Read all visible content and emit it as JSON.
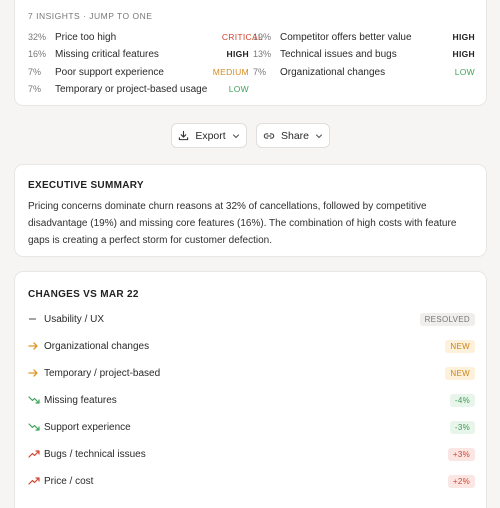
{
  "insights": {
    "header": "7 INSIGHTS · JUMP TO ONE",
    "items": [
      {
        "pct": "32%",
        "label": "Price too high",
        "severity": "CRITICAL",
        "level": "critical"
      },
      {
        "pct": "19%",
        "label": "Competitor offers better value",
        "severity": "HIGH",
        "level": "high"
      },
      {
        "pct": "16%",
        "label": "Missing critical features",
        "severity": "HIGH",
        "level": "high"
      },
      {
        "pct": "13%",
        "label": "Technical issues and bugs",
        "severity": "HIGH",
        "level": "high"
      },
      {
        "pct": "7%",
        "label": "Poor support experience",
        "severity": "MEDIUM",
        "level": "medium"
      },
      {
        "pct": "7%",
        "label": "Organizational changes",
        "severity": "LOW",
        "level": "low"
      },
      {
        "pct": "7%",
        "label": "Temporary or project-based usage",
        "severity": "LOW",
        "level": "low"
      }
    ]
  },
  "actions": {
    "export_label": "Export",
    "share_label": "Share"
  },
  "summary": {
    "title": "EXECUTIVE SUMMARY",
    "text": "Pricing concerns dominate churn reasons at 32% of cancellations, followed by competitive disadvantage (19%) and missing core features (16%). The combination of high costs with feature gaps is creating a perfect storm for customer defection."
  },
  "changes": {
    "title": "CHANGES VS MAR 22",
    "items": [
      {
        "label": "Usability / UX",
        "badge": "RESOLVED",
        "kind": "resolved",
        "icon": "dash-icon"
      },
      {
        "label": "Organizational changes",
        "badge": "NEW",
        "kind": "new",
        "icon": "arrow-right-icon"
      },
      {
        "label": "Temporary / project-based",
        "badge": "NEW",
        "kind": "new",
        "icon": "arrow-right-icon"
      },
      {
        "label": "Missing features",
        "badge": "-4%",
        "kind": "down",
        "icon": "trend-down-icon"
      },
      {
        "label": "Support experience",
        "badge": "-3%",
        "kind": "down",
        "icon": "trend-down-icon"
      },
      {
        "label": "Bugs / technical issues",
        "badge": "+3%",
        "kind": "up",
        "icon": "trend-up-icon"
      },
      {
        "label": "Price / cost",
        "badge": "+2%",
        "kind": "up",
        "icon": "trend-up-icon"
      }
    ]
  },
  "colors": {
    "critical": "#d0442f",
    "medium": "#d68a1f",
    "low": "#3ea35a",
    "new": "#e0962a"
  }
}
